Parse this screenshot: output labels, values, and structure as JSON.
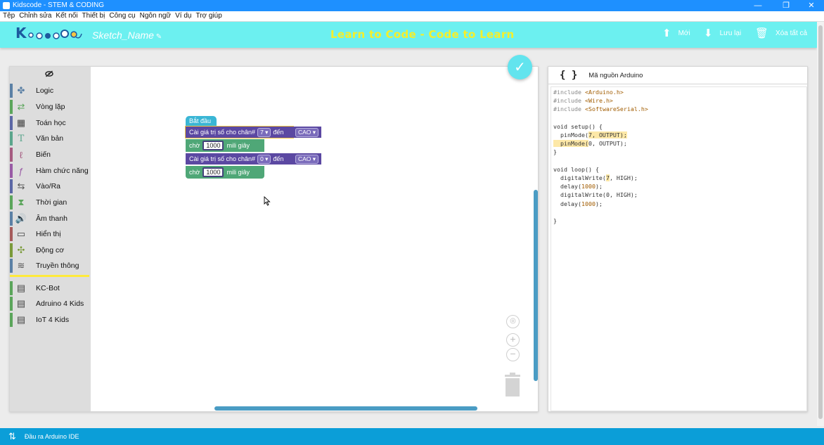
{
  "window": {
    "title": "Kidscode - STEM & CODING",
    "minimize": "—",
    "maximize": "❐",
    "close": "✕"
  },
  "menu": [
    "Tệp",
    "Chỉnh sửa",
    "Kết nối",
    "Thiết bị",
    "Công cụ",
    "Ngôn ngữ",
    "Ví dụ",
    "Trợ giúp"
  ],
  "header": {
    "logo_text": "Kidscode",
    "sketch_name": "Sketch_Name",
    "slogan": "Learn to Code - Code to Learn",
    "new_label": "Mới",
    "save_label": "Lưu lại",
    "delete_label": "Xóa tất cả"
  },
  "toolbox": {
    "categories": [
      {
        "label": "Logic",
        "color": "#5b80a5"
      },
      {
        "label": "Vòng lặp",
        "color": "#5ba55b"
      },
      {
        "label": "Toán học",
        "color": "#5b67a5"
      },
      {
        "label": "Văn bản",
        "color": "#5ba58c"
      },
      {
        "label": "Biến",
        "color": "#a55b80"
      },
      {
        "label": "Hàm chức năng",
        "color": "#995ba5"
      },
      {
        "label": "Vào/Ra",
        "color": "#5b67a5"
      },
      {
        "label": "Thời gian",
        "color": "#5ba55b"
      },
      {
        "label": "Âm thanh",
        "color": "#5b80a5"
      },
      {
        "label": "Hiển thị",
        "color": "#a55b5b"
      },
      {
        "label": "Động cơ",
        "color": "#7a9a3a"
      },
      {
        "label": "Truyền thông",
        "color": "#5b80a5"
      }
    ],
    "extensions": [
      {
        "label": "KC-Bot",
        "color": "#5ba55b"
      },
      {
        "label": "Adruino 4 Kids",
        "color": "#5ba55b"
      },
      {
        "label": "IoT 4 Kids",
        "color": "#5ba55b"
      }
    ]
  },
  "blocks": {
    "start": "Bắt đầu",
    "set_pin_1": {
      "label": "Cài giá trị số cho chân#",
      "pin": "7 ▾",
      "to": "đến",
      "value": "CAO ▾"
    },
    "wait_1": {
      "label": "chờ",
      "value": "1000",
      "unit": "mili giây"
    },
    "set_pin_2": {
      "label": "Cài giá trị số cho chân#",
      "pin": "0 ▾",
      "to": "đến",
      "value": "CAO ▾"
    },
    "wait_2": {
      "label": "chờ",
      "value": "1000",
      "unit": "mili giây"
    }
  },
  "code_panel": {
    "braces": "{ }",
    "title": "Mã nguồn Arduino",
    "inc1": "#include ",
    "inc1v": "<Arduino.h>",
    "inc2": "#include ",
    "inc2v": "<Wire.h>",
    "inc3": "#include ",
    "inc3v": "<SoftwareSerial.h>",
    "setup": "void setup() {",
    "pm1a": "  pinMode(",
    "pm1b": "7, OUTPUT);",
    "pm2a": "  pinMode(",
    "pm2b": "0",
    "pm2c": ", OUTPUT);",
    "close1": "}",
    "loop": "void loop() {",
    "dw1a": "  digitalWrite(",
    "dw1b": "7",
    "dw1c": ", HIGH);",
    "dl1a": "  delay(",
    "dl1b": "1000",
    "dl1c": ");",
    "dw2a": "  digitalWrite(",
    "dw2b": "0",
    "dw2c": ", HIGH);",
    "dl2a": "  delay(",
    "dl2b": "1000",
    "dl2c": ");",
    "close2": "}"
  },
  "status": {
    "label": "Đầu ra Arduino IDE"
  }
}
